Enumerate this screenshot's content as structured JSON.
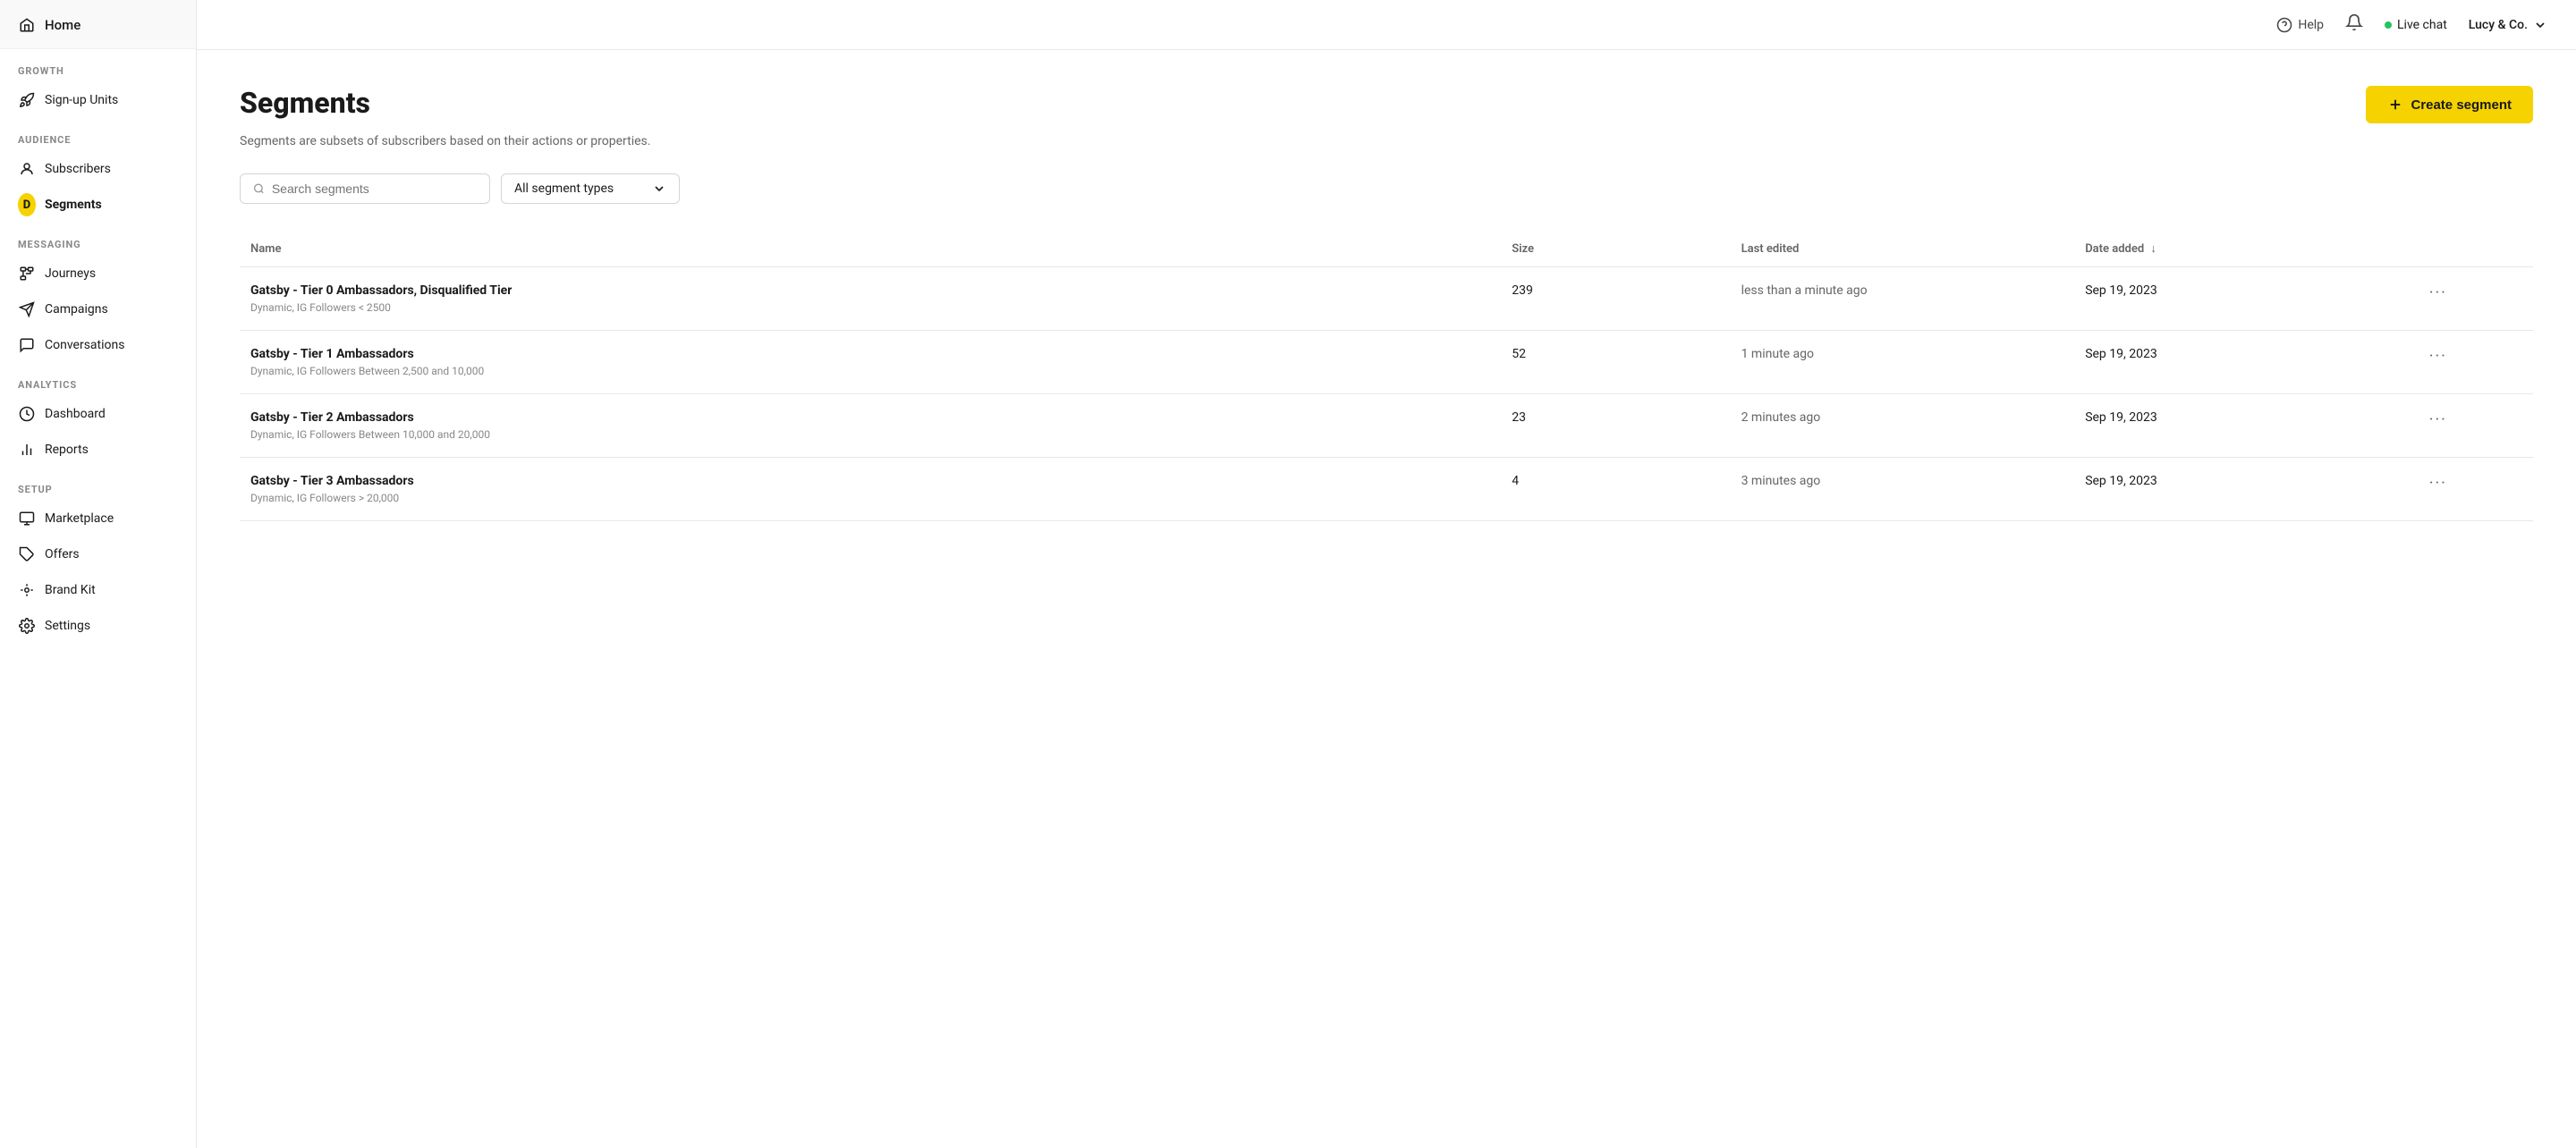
{
  "sidebar": {
    "home_label": "Home",
    "sections": [
      {
        "label": "Growth",
        "items": [
          {
            "id": "signup-units",
            "label": "Sign-up Units",
            "icon": "rocket-icon"
          }
        ]
      },
      {
        "label": "Audience",
        "items": [
          {
            "id": "subscribers",
            "label": "Subscribers",
            "icon": "person-icon"
          },
          {
            "id": "segments",
            "label": "Segments",
            "icon": "segments-icon",
            "active": true
          }
        ]
      },
      {
        "label": "Messaging",
        "items": [
          {
            "id": "journeys",
            "label": "Journeys",
            "icon": "journeys-icon"
          },
          {
            "id": "campaigns",
            "label": "Campaigns",
            "icon": "campaigns-icon"
          },
          {
            "id": "conversations",
            "label": "Conversations",
            "icon": "conversations-icon"
          }
        ]
      },
      {
        "label": "Analytics",
        "items": [
          {
            "id": "dashboard",
            "label": "Dashboard",
            "icon": "dashboard-icon"
          },
          {
            "id": "reports",
            "label": "Reports",
            "icon": "reports-icon"
          }
        ]
      },
      {
        "label": "Setup",
        "items": [
          {
            "id": "marketplace",
            "label": "Marketplace",
            "icon": "marketplace-icon"
          },
          {
            "id": "offers",
            "label": "Offers",
            "icon": "offers-icon"
          },
          {
            "id": "brand-kit",
            "label": "Brand Kit",
            "icon": "brand-kit-icon"
          },
          {
            "id": "settings",
            "label": "Settings",
            "icon": "settings-icon"
          }
        ]
      }
    ]
  },
  "topbar": {
    "help_label": "Help",
    "live_chat_label": "Live chat",
    "account_label": "Lucy & Co."
  },
  "page": {
    "title": "Segments",
    "subtitle": "Segments are subsets of subscribers based on their actions or properties.",
    "create_button_label": "Create segment"
  },
  "filters": {
    "search_placeholder": "Search segments",
    "type_filter_label": "All segment types"
  },
  "table": {
    "columns": {
      "name": "Name",
      "size": "Size",
      "last_edited": "Last edited",
      "date_added": "Date added"
    },
    "rows": [
      {
        "name": "Gatsby - Tier 0 Ambassadors, Disqualified Tier",
        "meta": "Dynamic, IG Followers < 2500",
        "size": "239",
        "last_edited": "less than a minute ago",
        "date_added": "Sep 19, 2023"
      },
      {
        "name": "Gatsby - Tier 1 Ambassadors",
        "meta": "Dynamic, IG Followers Between 2,500 and 10,000",
        "size": "52",
        "last_edited": "1 minute ago",
        "date_added": "Sep 19, 2023"
      },
      {
        "name": "Gatsby - Tier 2 Ambassadors",
        "meta": "Dynamic, IG Followers Between 10,000 and 20,000",
        "size": "23",
        "last_edited": "2 minutes ago",
        "date_added": "Sep 19, 2023"
      },
      {
        "name": "Gatsby - Tier 3 Ambassadors",
        "meta": "Dynamic, IG Followers > 20,000",
        "size": "4",
        "last_edited": "3 minutes ago",
        "date_added": "Sep 19, 2023"
      }
    ]
  }
}
